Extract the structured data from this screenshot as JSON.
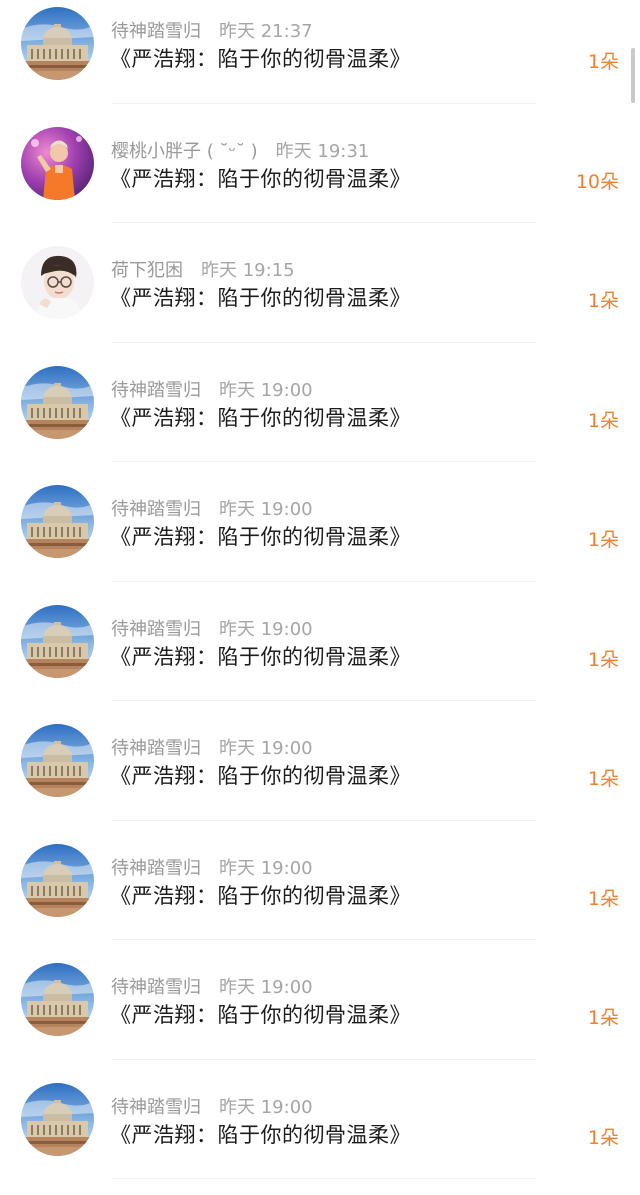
{
  "colors": {
    "accent": "#f08232",
    "meta_text": "#9a9a9a",
    "title_text": "#1c1c1c"
  },
  "items": [
    {
      "user": "待神踏雪归",
      "time": "昨天 21:37",
      "title": "《严浩翔：陷于你的彻骨温柔》",
      "count": "1朵",
      "avatar": "vatican-basilica"
    },
    {
      "user": "樱桃小胖子 ( ˘ᵕ˘ )",
      "time": "昨天 19:31",
      "title": "《严浩翔：陷于你的彻骨温柔》",
      "count": "10朵",
      "avatar": "performer-photo"
    },
    {
      "user": "荷下犯困",
      "time": "昨天 19:15",
      "title": "《严浩翔：陷于你的彻骨温柔》",
      "count": "1朵",
      "avatar": "glasses-boy-illustration"
    },
    {
      "user": "待神踏雪归",
      "time": "昨天 19:00",
      "title": "《严浩翔：陷于你的彻骨温柔》",
      "count": "1朵",
      "avatar": "vatican-basilica"
    },
    {
      "user": "待神踏雪归",
      "time": "昨天 19:00",
      "title": "《严浩翔：陷于你的彻骨温柔》",
      "count": "1朵",
      "avatar": "vatican-basilica"
    },
    {
      "user": "待神踏雪归",
      "time": "昨天 19:00",
      "title": "《严浩翔：陷于你的彻骨温柔》",
      "count": "1朵",
      "avatar": "vatican-basilica"
    },
    {
      "user": "待神踏雪归",
      "time": "昨天 19:00",
      "title": "《严浩翔：陷于你的彻骨温柔》",
      "count": "1朵",
      "avatar": "vatican-basilica"
    },
    {
      "user": "待神踏雪归",
      "time": "昨天 19:00",
      "title": "《严浩翔：陷于你的彻骨温柔》",
      "count": "1朵",
      "avatar": "vatican-basilica"
    },
    {
      "user": "待神踏雪归",
      "time": "昨天 19:00",
      "title": "《严浩翔：陷于你的彻骨温柔》",
      "count": "1朵",
      "avatar": "vatican-basilica"
    },
    {
      "user": "待神踏雪归",
      "time": "昨天 19:00",
      "title": "《严浩翔：陷于你的彻骨温柔》",
      "count": "1朵",
      "avatar": "vatican-basilica"
    }
  ]
}
